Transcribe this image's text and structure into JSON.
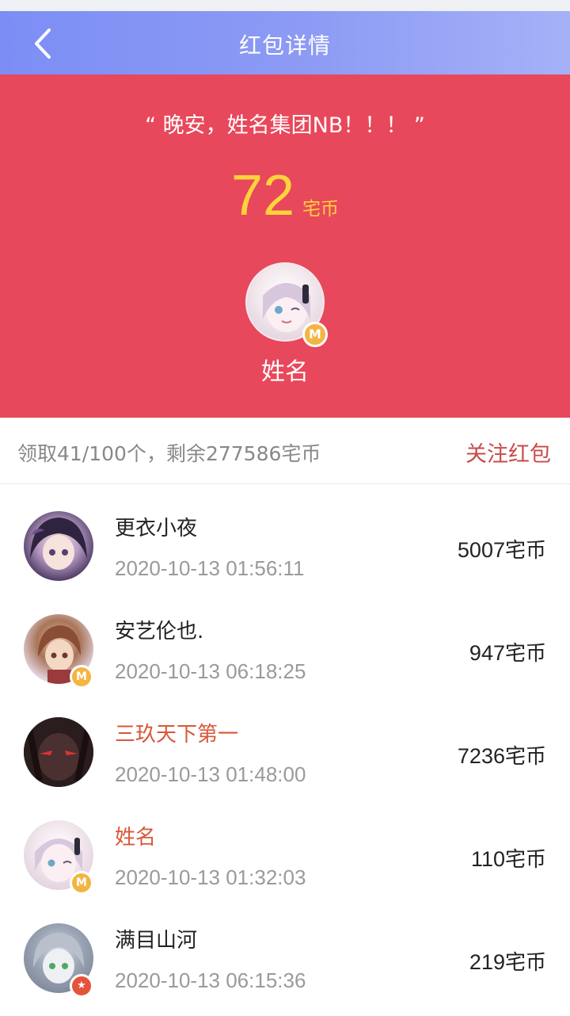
{
  "header": {
    "title": "红包详情",
    "back_icon": "chevron-left-icon"
  },
  "hero": {
    "greeting": "“ 晚安，姓名集团NB！！！ ”",
    "amount": "72",
    "unit": "宅币",
    "sender_name": "姓名",
    "sender_badge": "M",
    "background_color": "#e8485b",
    "amount_color": "#ffd33b"
  },
  "summary": {
    "text": "领取41/100个，剩余277586宅币",
    "follow_label": "关注红包"
  },
  "records": [
    {
      "name": "更衣小夜",
      "time": "2020-10-13 01:56:11",
      "amount": "5007",
      "unit": "宅币",
      "highlight": false,
      "badge": ""
    },
    {
      "name": "安艺伦也.",
      "time": "2020-10-13 06:18:25",
      "amount": "947",
      "unit": "宅币",
      "highlight": false,
      "badge": "M"
    },
    {
      "name": "三玖天下第一",
      "time": "2020-10-13 01:48:00",
      "amount": "7236",
      "unit": "宅币",
      "highlight": true,
      "badge": ""
    },
    {
      "name": "姓名",
      "time": "2020-10-13 01:32:03",
      "amount": "110",
      "unit": "宅币",
      "highlight": true,
      "badge": "M"
    },
    {
      "name": "满目山河",
      "time": "2020-10-13 06:15:36",
      "amount": "219",
      "unit": "宅币",
      "highlight": false,
      "badge": "star-icon"
    }
  ]
}
